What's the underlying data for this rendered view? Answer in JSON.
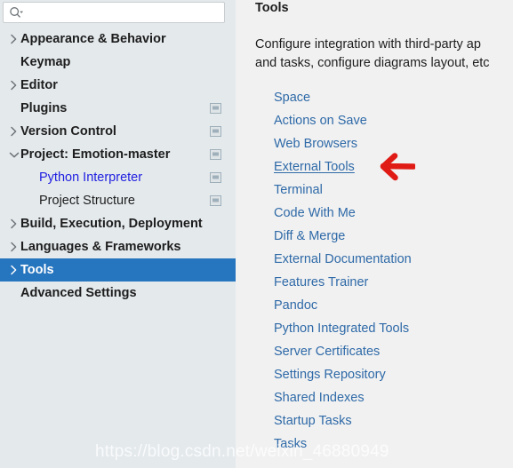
{
  "search": {
    "placeholder": "",
    "value": "",
    "icon": "search-icon",
    "dropdown_icon": "chevron-down-icon"
  },
  "sidebar": {
    "items": [
      {
        "label": "Appearance & Behavior",
        "twisty": "chevron-right-icon",
        "indent": 0,
        "bold": true,
        "blue": false,
        "selected": false,
        "scope_icon": false
      },
      {
        "label": "Keymap",
        "twisty": "none",
        "indent": 0,
        "bold": true,
        "blue": false,
        "selected": false,
        "scope_icon": false
      },
      {
        "label": "Editor",
        "twisty": "chevron-right-icon",
        "indent": 0,
        "bold": true,
        "blue": false,
        "selected": false,
        "scope_icon": false
      },
      {
        "label": "Plugins",
        "twisty": "none",
        "indent": 0,
        "bold": true,
        "blue": false,
        "selected": false,
        "scope_icon": true
      },
      {
        "label": "Version Control",
        "twisty": "chevron-right-icon",
        "indent": 0,
        "bold": true,
        "blue": false,
        "selected": false,
        "scope_icon": true
      },
      {
        "label": "Project: Emotion-master",
        "twisty": "chevron-down-icon",
        "indent": 0,
        "bold": true,
        "blue": false,
        "selected": false,
        "scope_icon": true
      },
      {
        "label": "Python Interpreter",
        "twisty": "none",
        "indent": 1,
        "bold": false,
        "blue": true,
        "selected": false,
        "scope_icon": true
      },
      {
        "label": "Project Structure",
        "twisty": "none",
        "indent": 1,
        "bold": false,
        "blue": false,
        "selected": false,
        "scope_icon": true
      },
      {
        "label": "Build, Execution, Deployment",
        "twisty": "chevron-right-icon",
        "indent": 0,
        "bold": true,
        "blue": false,
        "selected": false,
        "scope_icon": false
      },
      {
        "label": "Languages & Frameworks",
        "twisty": "chevron-right-icon",
        "indent": 0,
        "bold": true,
        "blue": false,
        "selected": false,
        "scope_icon": false
      },
      {
        "label": "Tools",
        "twisty": "chevron-right-icon",
        "indent": 0,
        "bold": true,
        "blue": false,
        "selected": true,
        "scope_icon": false
      },
      {
        "label": "Advanced Settings",
        "twisty": "none",
        "indent": 0,
        "bold": true,
        "blue": false,
        "selected": false,
        "scope_icon": false
      }
    ]
  },
  "detail": {
    "title": "Tools",
    "description_line1": "Configure integration with third-party ap",
    "description_line2": "and tasks, configure diagrams layout, etc",
    "links": [
      {
        "label": "Space",
        "hovered": false
      },
      {
        "label": "Actions on Save",
        "hovered": false
      },
      {
        "label": "Web Browsers",
        "hovered": false
      },
      {
        "label": "External Tools",
        "hovered": true
      },
      {
        "label": "Terminal",
        "hovered": false
      },
      {
        "label": "Code With Me",
        "hovered": false
      },
      {
        "label": "Diff & Merge",
        "hovered": false
      },
      {
        "label": "External Documentation",
        "hovered": false
      },
      {
        "label": "Features Trainer",
        "hovered": false
      },
      {
        "label": "Pandoc",
        "hovered": false
      },
      {
        "label": "Python Integrated Tools",
        "hovered": false
      },
      {
        "label": "Server Certificates",
        "hovered": false
      },
      {
        "label": "Settings Repository",
        "hovered": false
      },
      {
        "label": "Shared Indexes",
        "hovered": false
      },
      {
        "label": "Startup Tasks",
        "hovered": false
      },
      {
        "label": "Tasks",
        "hovered": false
      }
    ]
  },
  "annotation": {
    "arrow": "arrow-left-icon",
    "color": "#e01b15",
    "points_at": "External Tools"
  },
  "watermark": {
    "text": "https://blog.csdn.net/weixin_46880949"
  },
  "colors": {
    "sidebar_bg": "#e4e9ec",
    "detail_bg": "#f1f1f1",
    "selection_blue": "#2675bf",
    "link_blue": "#2f6aa8",
    "interpreter_blue": "#2121e0",
    "text": "#1d1d1d",
    "annotation_red": "#e01b15"
  }
}
